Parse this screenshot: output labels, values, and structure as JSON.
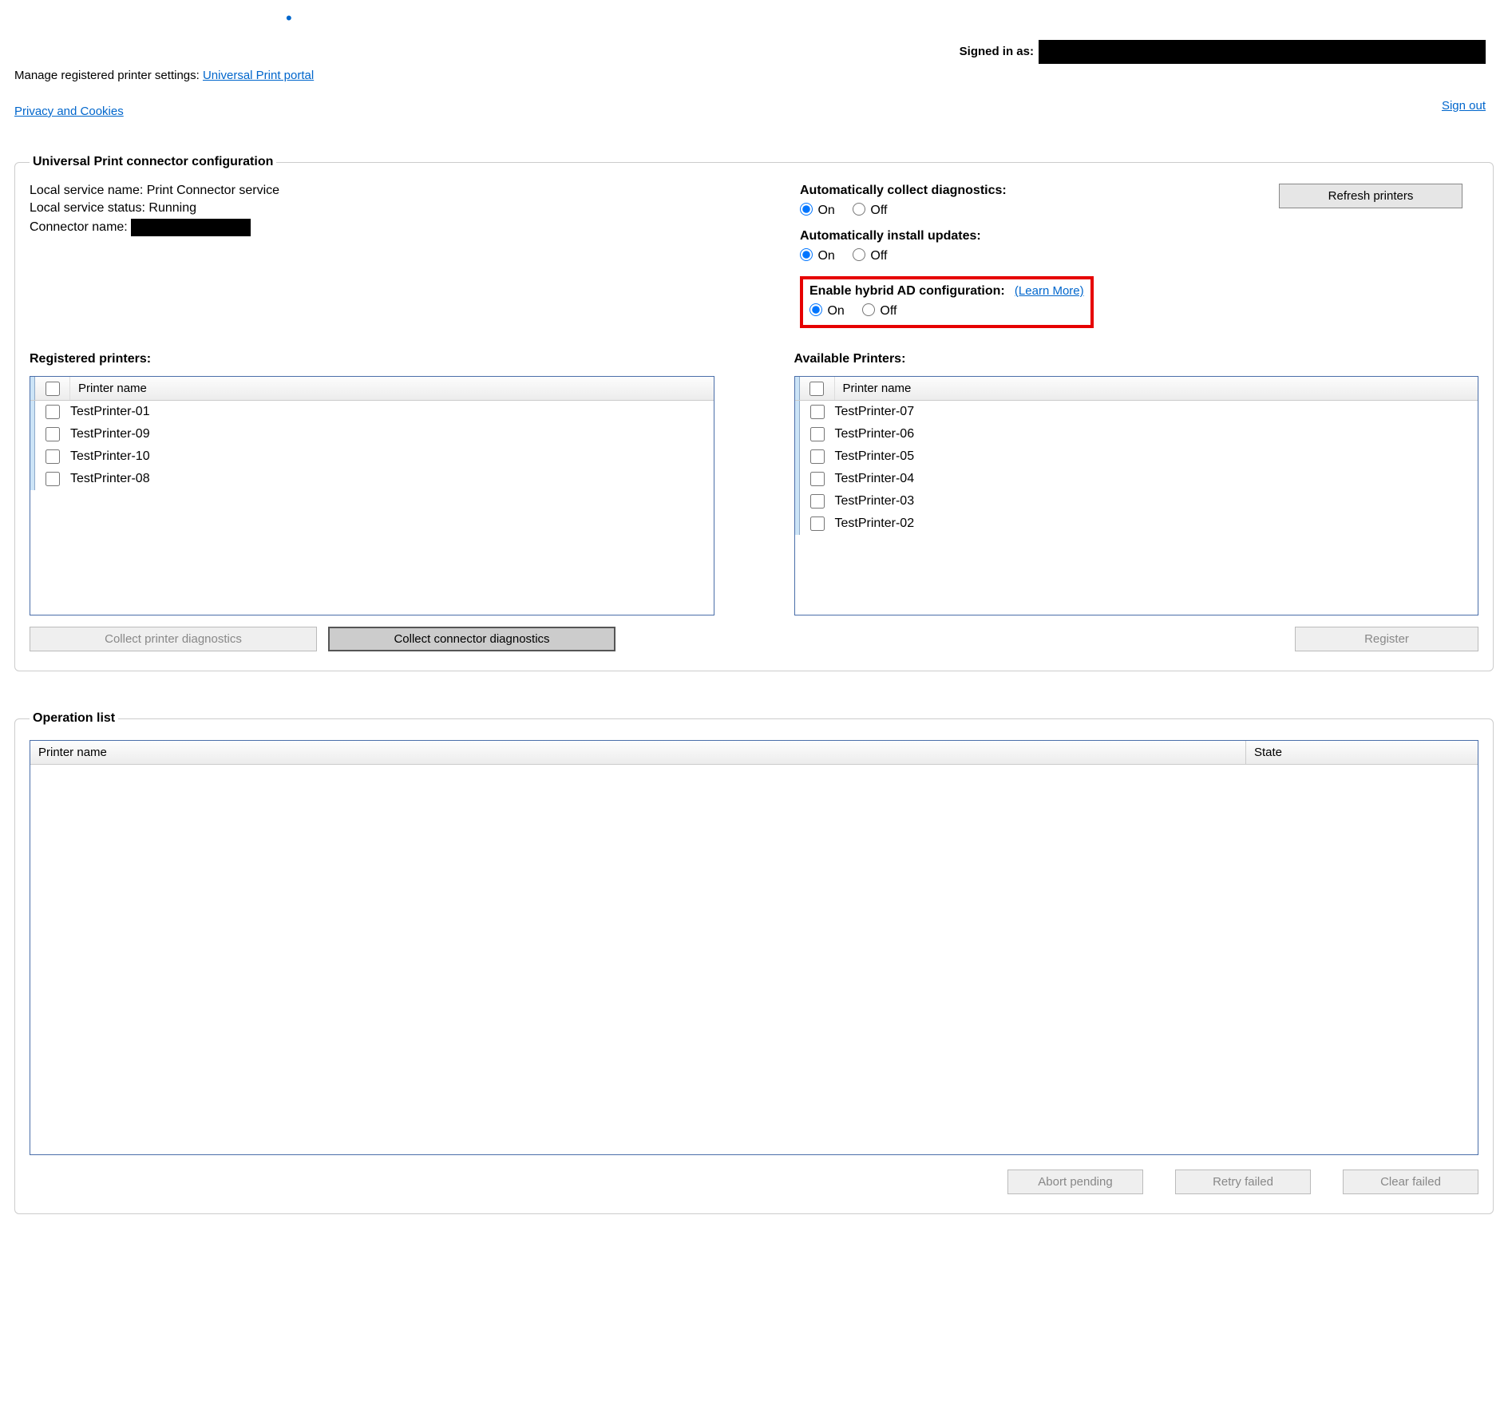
{
  "topbar": {
    "signed_in_label": "Signed in as:",
    "sign_out": "Sign out",
    "manage_label": "Manage registered printer settings: ",
    "portal_link": "Universal Print portal",
    "privacy_link": "Privacy and Cookies"
  },
  "config": {
    "legend": "Universal Print connector configuration",
    "service_name_label": "Local service name: ",
    "service_name_value": "Print Connector service",
    "service_status_label": "Local service status: ",
    "service_status_value": "Running",
    "connector_name_label": "Connector name: ",
    "refresh_btn": "Refresh printers",
    "diag": {
      "label": "Automatically collect diagnostics:",
      "on": "On",
      "off": "Off",
      "selected": "on"
    },
    "updates": {
      "label": "Automatically install updates:",
      "on": "On",
      "off": "Off",
      "selected": "on"
    },
    "hybrid": {
      "label": "Enable hybrid AD configuration:",
      "learn_more": "(Learn More)",
      "on": "On",
      "off": "Off",
      "selected": "on"
    }
  },
  "lists": {
    "registered_heading": "Registered printers:",
    "available_heading": "Available Printers:",
    "header_col": "Printer name",
    "registered_items": [
      "TestPrinter-01",
      "TestPrinter-09",
      "TestPrinter-10",
      "TestPrinter-08"
    ],
    "available_items": [
      "TestPrinter-07",
      "TestPrinter-06",
      "TestPrinter-05",
      "TestPrinter-04",
      "TestPrinter-03",
      "TestPrinter-02"
    ],
    "collect_printer_diag_btn": "Collect printer diagnostics",
    "collect_connector_diag_btn": "Collect connector diagnostics",
    "register_btn": "Register"
  },
  "ops": {
    "legend": "Operation list",
    "col_printer": "Printer name",
    "col_state": "State",
    "abort_btn": "Abort pending",
    "retry_btn": "Retry failed",
    "clear_btn": "Clear failed"
  }
}
